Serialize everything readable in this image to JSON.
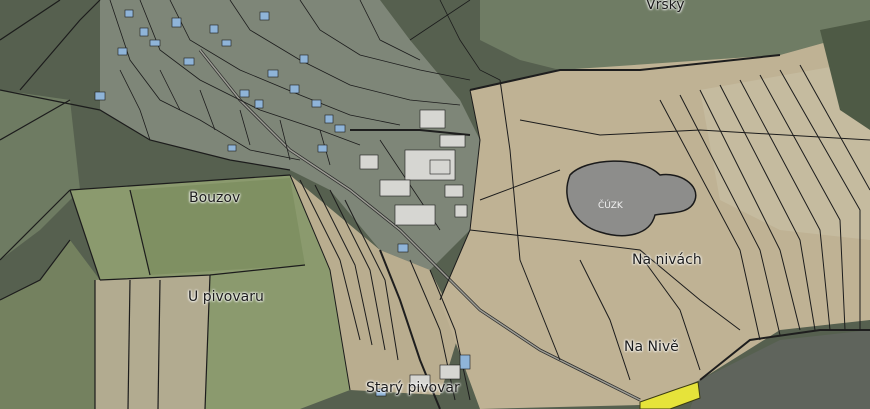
{
  "map": {
    "labels": {
      "vrsky": "Vršky",
      "bouzov": "Bouzov",
      "u_pivovaru": "U pivovaru",
      "na_nivach": "Na nivách",
      "na_nive": "Na Nivě",
      "stary_pivovar": "Starý pivovar",
      "cuzk": "ČÚZK"
    }
  }
}
